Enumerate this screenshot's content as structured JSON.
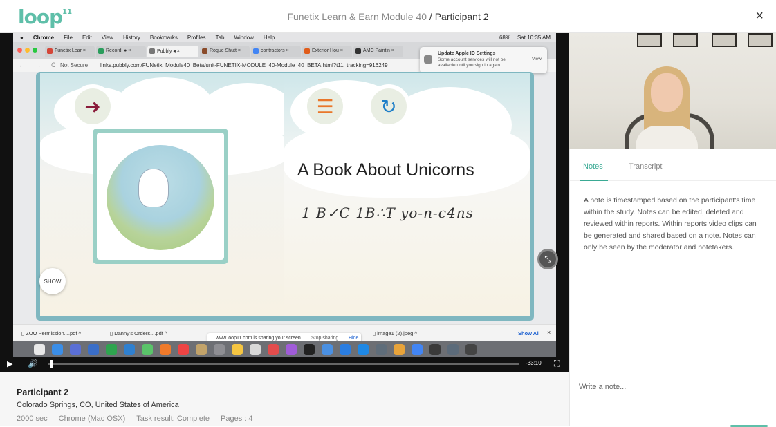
{
  "header": {
    "logo": "loop",
    "logo_sup": "11",
    "module": "Funetix Learn & Earn Module 40",
    "separator": "/",
    "participant": "Participant 2",
    "close": "×"
  },
  "recording": {
    "mac_menu": {
      "app": "Chrome",
      "items": [
        "File",
        "Edit",
        "View",
        "History",
        "Bookmarks",
        "Profiles",
        "Tab",
        "Window",
        "Help"
      ],
      "battery": "68%",
      "clock": "Sat 10:35 AM"
    },
    "tabs": [
      {
        "label": "Funetix Lear",
        "color": "#d44638"
      },
      {
        "label": "Recordi",
        "color": "#2a9d5c"
      },
      {
        "label": "Pubbly",
        "color": "#777777"
      },
      {
        "label": "Rogue Shutt",
        "color": "#8a4b2a"
      },
      {
        "label": "contractors",
        "color": "#4285f4"
      },
      {
        "label": "Exterior Hou",
        "color": "#e05c1a"
      },
      {
        "label": "AMC Paintin",
        "color": "#333333"
      }
    ],
    "address": {
      "nav": "← → C",
      "security": "Not Secure",
      "url": "links.pubbly.com/FUNetix_Module40_Beta/unit-FUNETIX-MODULE_40-Module_40_BETA.html?t11_tracking=916249"
    },
    "notification": {
      "title": "Update Apple ID Settings",
      "body": "Some account services will not be available until you sign in again.",
      "action": "View"
    },
    "book": {
      "title": "A Book About Unicorns",
      "phonetic": "1 B✓C 1B∴T yo-n-c4ns",
      "show_label": "SHOW"
    },
    "downloads": {
      "items": [
        "ZOO Permission....pdf",
        "Danny's Orders....pdf",
        "image1 (2).jpeg"
      ],
      "show_all": "Show All",
      "close": "×"
    },
    "sharing": {
      "message": "www.loop11.com is sharing your screen.",
      "stop": "Stop sharing",
      "hide": "Hide"
    },
    "controls": {
      "play": "▶",
      "volume": "🔊",
      "time": "-33:10",
      "fullscreen": "⛶",
      "progress": 0.003
    }
  },
  "panel": {
    "tabs": [
      "Notes",
      "Transcript"
    ],
    "active_tab": "Notes",
    "notes_info": "A note is timestamped based on the participant's time within the study. Notes can be edited, deleted and reviewed within reports. Within reports video clips can be generated and shared based on a note. Notes can only be seen by the moderator and notetakers.",
    "note_placeholder": "Write a note..."
  },
  "participant": {
    "name": "Participant 2",
    "location": "Colorado Springs, CO, United States of America",
    "duration": "2000 sec",
    "browser": "Chrome (Mac OSX)",
    "task_result": "Task result: Complete",
    "pages": "Pages : 4"
  },
  "colors": {
    "brand": "#5fbfa9",
    "accent": "#3aaa94"
  }
}
